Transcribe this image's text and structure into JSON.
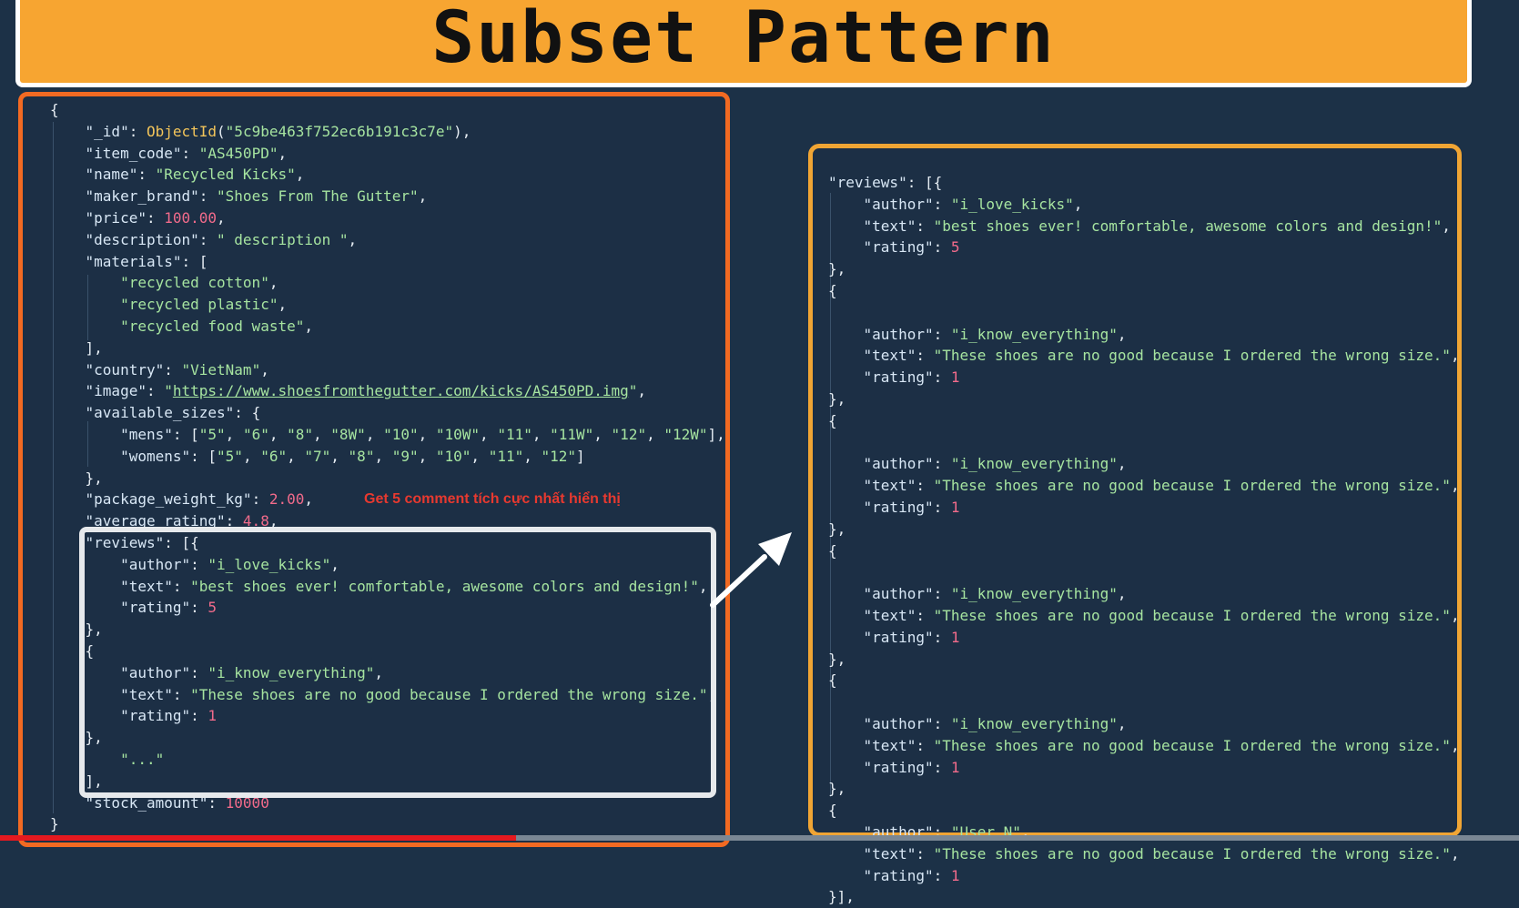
{
  "title": "Subset Pattern",
  "annotation": "Get 5 comment tích cực nhất hiển thị",
  "left_lines": [
    [
      [
        "p",
        "{"
      ]
    ],
    [
      [
        "k",
        "    \"_id\""
      ],
      [
        "p",
        ": "
      ],
      [
        "f",
        "ObjectId"
      ],
      [
        "p",
        "("
      ],
      [
        "s",
        "\"5c9be463f752ec6b191c3c7e\""
      ],
      [
        "p",
        "),"
      ]
    ],
    [
      [
        "k",
        "    \"item_code\""
      ],
      [
        "p",
        ": "
      ],
      [
        "s",
        "\"AS450PD\""
      ],
      [
        "p",
        ","
      ]
    ],
    [
      [
        "k",
        "    \"name\""
      ],
      [
        "p",
        ": "
      ],
      [
        "s",
        "\"Recycled Kicks\""
      ],
      [
        "p",
        ","
      ]
    ],
    [
      [
        "k",
        "    \"maker_brand\""
      ],
      [
        "p",
        ": "
      ],
      [
        "s",
        "\"Shoes From The Gutter\""
      ],
      [
        "p",
        ","
      ]
    ],
    [
      [
        "k",
        "    \"price\""
      ],
      [
        "p",
        ": "
      ],
      [
        "n",
        "100.00"
      ],
      [
        "p",
        ","
      ]
    ],
    [
      [
        "k",
        "    \"description\""
      ],
      [
        "p",
        ": "
      ],
      [
        "s",
        "\" description \""
      ],
      [
        "p",
        ","
      ]
    ],
    [
      [
        "k",
        "    \"materials\""
      ],
      [
        "p",
        ": ["
      ]
    ],
    [
      [
        "s",
        "        \"recycled cotton\""
      ],
      [
        "p",
        ","
      ]
    ],
    [
      [
        "s",
        "        \"recycled plastic\""
      ],
      [
        "p",
        ","
      ]
    ],
    [
      [
        "s",
        "        \"recycled food waste\""
      ],
      [
        "p",
        ","
      ]
    ],
    [
      [
        "p",
        "    ],"
      ]
    ],
    [
      [
        "k",
        "    \"country\""
      ],
      [
        "p",
        ": "
      ],
      [
        "s",
        "\"VietNam\""
      ],
      [
        "p",
        ","
      ]
    ],
    [
      [
        "k",
        "    \"image\""
      ],
      [
        "p",
        ": "
      ],
      [
        "s",
        "\""
      ],
      [
        "u",
        "https://www.shoesfromthegutter.com/kicks/AS450PD.img"
      ],
      [
        "s",
        "\""
      ],
      [
        "p",
        ","
      ]
    ],
    [
      [
        "k",
        "    \"available_sizes\""
      ],
      [
        "p",
        ": {"
      ]
    ],
    [
      [
        "k",
        "        \"mens\""
      ],
      [
        "p",
        ": ["
      ],
      [
        "s",
        "\"5\""
      ],
      [
        "p",
        ", "
      ],
      [
        "s",
        "\"6\""
      ],
      [
        "p",
        ", "
      ],
      [
        "s",
        "\"8\""
      ],
      [
        "p",
        ", "
      ],
      [
        "s",
        "\"8W\""
      ],
      [
        "p",
        ", "
      ],
      [
        "s",
        "\"10\""
      ],
      [
        "p",
        ", "
      ],
      [
        "s",
        "\"10W\""
      ],
      [
        "p",
        ", "
      ],
      [
        "s",
        "\"11\""
      ],
      [
        "p",
        ", "
      ],
      [
        "s",
        "\"11W\""
      ],
      [
        "p",
        ", "
      ],
      [
        "s",
        "\"12\""
      ],
      [
        "p",
        ", "
      ],
      [
        "s",
        "\"12W\""
      ],
      [
        "p",
        "],"
      ]
    ],
    [
      [
        "k",
        "        \"womens\""
      ],
      [
        "p",
        ": ["
      ],
      [
        "s",
        "\"5\""
      ],
      [
        "p",
        ", "
      ],
      [
        "s",
        "\"6\""
      ],
      [
        "p",
        ", "
      ],
      [
        "s",
        "\"7\""
      ],
      [
        "p",
        ", "
      ],
      [
        "s",
        "\"8\""
      ],
      [
        "p",
        ", "
      ],
      [
        "s",
        "\"9\""
      ],
      [
        "p",
        ", "
      ],
      [
        "s",
        "\"10\""
      ],
      [
        "p",
        ", "
      ],
      [
        "s",
        "\"11\""
      ],
      [
        "p",
        ", "
      ],
      [
        "s",
        "\"12\""
      ],
      [
        "p",
        "]"
      ]
    ],
    [
      [
        "p",
        "    },"
      ]
    ],
    [
      [
        "k",
        "    \"package_weight_kg\""
      ],
      [
        "p",
        ": "
      ],
      [
        "n",
        "2.00"
      ],
      [
        "p",
        ","
      ]
    ],
    [
      [
        "k",
        "    \"average_rating\""
      ],
      [
        "p",
        ": "
      ],
      [
        "n",
        "4.8"
      ],
      [
        "p",
        ","
      ]
    ],
    [
      [
        "k",
        "    \"reviews\""
      ],
      [
        "p",
        ": [{"
      ]
    ],
    [
      [
        "k",
        "        \"author\""
      ],
      [
        "p",
        ": "
      ],
      [
        "s",
        "\"i_love_kicks\""
      ],
      [
        "p",
        ","
      ]
    ],
    [
      [
        "k",
        "        \"text\""
      ],
      [
        "p",
        ": "
      ],
      [
        "s",
        "\"best shoes ever! comfortable, awesome colors and design!\""
      ],
      [
        "p",
        ","
      ]
    ],
    [
      [
        "k",
        "        \"rating\""
      ],
      [
        "p",
        ": "
      ],
      [
        "n",
        "5"
      ]
    ],
    [
      [
        "p",
        "    },"
      ]
    ],
    [
      [
        "p",
        "    {"
      ]
    ],
    [
      [
        "k",
        "        \"author\""
      ],
      [
        "p",
        ": "
      ],
      [
        "s",
        "\"i_know_everything\""
      ],
      [
        "p",
        ","
      ]
    ],
    [
      [
        "k",
        "        \"text\""
      ],
      [
        "p",
        ": "
      ],
      [
        "s",
        "\"These shoes are no good because I ordered the wrong size.\""
      ],
      [
        "p",
        ","
      ]
    ],
    [
      [
        "k",
        "        \"rating\""
      ],
      [
        "p",
        ": "
      ],
      [
        "n",
        "1"
      ]
    ],
    [
      [
        "p",
        "    },"
      ]
    ],
    [
      [
        "s",
        "        \"...\""
      ]
    ],
    [
      [
        "p",
        "    ],"
      ]
    ],
    [
      [
        "k",
        "    \"stock_amount\""
      ],
      [
        "p",
        ": "
      ],
      [
        "n",
        "10000"
      ]
    ],
    [
      [
        "p",
        "}"
      ]
    ]
  ],
  "right_lines": [
    [
      [
        "k",
        "\"reviews\""
      ],
      [
        "p",
        ": [{"
      ]
    ],
    [
      [
        "k",
        "    \"author\""
      ],
      [
        "p",
        ": "
      ],
      [
        "s",
        "\"i_love_kicks\""
      ],
      [
        "p",
        ","
      ]
    ],
    [
      [
        "k",
        "    \"text\""
      ],
      [
        "p",
        ": "
      ],
      [
        "s",
        "\"best shoes ever! comfortable, awesome colors and design!\""
      ],
      [
        "p",
        ","
      ]
    ],
    [
      [
        "k",
        "    \"rating\""
      ],
      [
        "p",
        ": "
      ],
      [
        "n",
        "5"
      ]
    ],
    [
      [
        "p",
        "},"
      ]
    ],
    [
      [
        "p",
        "{"
      ]
    ],
    [
      [
        "p",
        ""
      ]
    ],
    [
      [
        "k",
        "    \"author\""
      ],
      [
        "p",
        ": "
      ],
      [
        "s",
        "\"i_know_everything\""
      ],
      [
        "p",
        ","
      ]
    ],
    [
      [
        "k",
        "    \"text\""
      ],
      [
        "p",
        ": "
      ],
      [
        "s",
        "\"These shoes are no good because I ordered the wrong size.\""
      ],
      [
        "p",
        ","
      ]
    ],
    [
      [
        "k",
        "    \"rating\""
      ],
      [
        "p",
        ": "
      ],
      [
        "n",
        "1"
      ]
    ],
    [
      [
        "p",
        "},"
      ]
    ],
    [
      [
        "p",
        "{"
      ]
    ],
    [
      [
        "p",
        ""
      ]
    ],
    [
      [
        "k",
        "    \"author\""
      ],
      [
        "p",
        ": "
      ],
      [
        "s",
        "\"i_know_everything\""
      ],
      [
        "p",
        ","
      ]
    ],
    [
      [
        "k",
        "    \"text\""
      ],
      [
        "p",
        ": "
      ],
      [
        "s",
        "\"These shoes are no good because I ordered the wrong size.\""
      ],
      [
        "p",
        ","
      ]
    ],
    [
      [
        "k",
        "    \"rating\""
      ],
      [
        "p",
        ": "
      ],
      [
        "n",
        "1"
      ]
    ],
    [
      [
        "p",
        "},"
      ]
    ],
    [
      [
        "p",
        "{"
      ]
    ],
    [
      [
        "p",
        ""
      ]
    ],
    [
      [
        "k",
        "    \"author\""
      ],
      [
        "p",
        ": "
      ],
      [
        "s",
        "\"i_know_everything\""
      ],
      [
        "p",
        ","
      ]
    ],
    [
      [
        "k",
        "    \"text\""
      ],
      [
        "p",
        ": "
      ],
      [
        "s",
        "\"These shoes are no good because I ordered the wrong size.\""
      ],
      [
        "p",
        ","
      ]
    ],
    [
      [
        "k",
        "    \"rating\""
      ],
      [
        "p",
        ": "
      ],
      [
        "n",
        "1"
      ]
    ],
    [
      [
        "p",
        "},"
      ]
    ],
    [
      [
        "p",
        "{"
      ]
    ],
    [
      [
        "p",
        ""
      ]
    ],
    [
      [
        "k",
        "    \"author\""
      ],
      [
        "p",
        ": "
      ],
      [
        "s",
        "\"i_know_everything\""
      ],
      [
        "p",
        ","
      ]
    ],
    [
      [
        "k",
        "    \"text\""
      ],
      [
        "p",
        ": "
      ],
      [
        "s",
        "\"These shoes are no good because I ordered the wrong size.\""
      ],
      [
        "p",
        ","
      ]
    ],
    [
      [
        "k",
        "    \"rating\""
      ],
      [
        "p",
        ": "
      ],
      [
        "n",
        "1"
      ]
    ],
    [
      [
        "p",
        "},"
      ]
    ],
    [
      [
        "p",
        "{"
      ]
    ],
    [
      [
        "k",
        "    \"author\""
      ],
      [
        "p",
        ": "
      ],
      [
        "s",
        "\"User N\""
      ],
      [
        "p",
        ","
      ]
    ],
    [
      [
        "k",
        "    \"text\""
      ],
      [
        "p",
        ": "
      ],
      [
        "s",
        "\"These shoes are no good because I ordered the wrong size.\""
      ],
      [
        "p",
        ","
      ]
    ],
    [
      [
        "k",
        "    \"rating\""
      ],
      [
        "p",
        ": "
      ],
      [
        "n",
        "1"
      ]
    ],
    [
      [
        "p",
        "}],"
      ]
    ]
  ],
  "video_progress": 0.34,
  "colors": {
    "background": "#1c3147",
    "title_bar": "#f7a531",
    "left_border": "#f26a22",
    "right_border": "#f0a534",
    "highlight_border": "#e6e9ec",
    "annotation": "#e8392f",
    "progress": "#e5191f"
  }
}
